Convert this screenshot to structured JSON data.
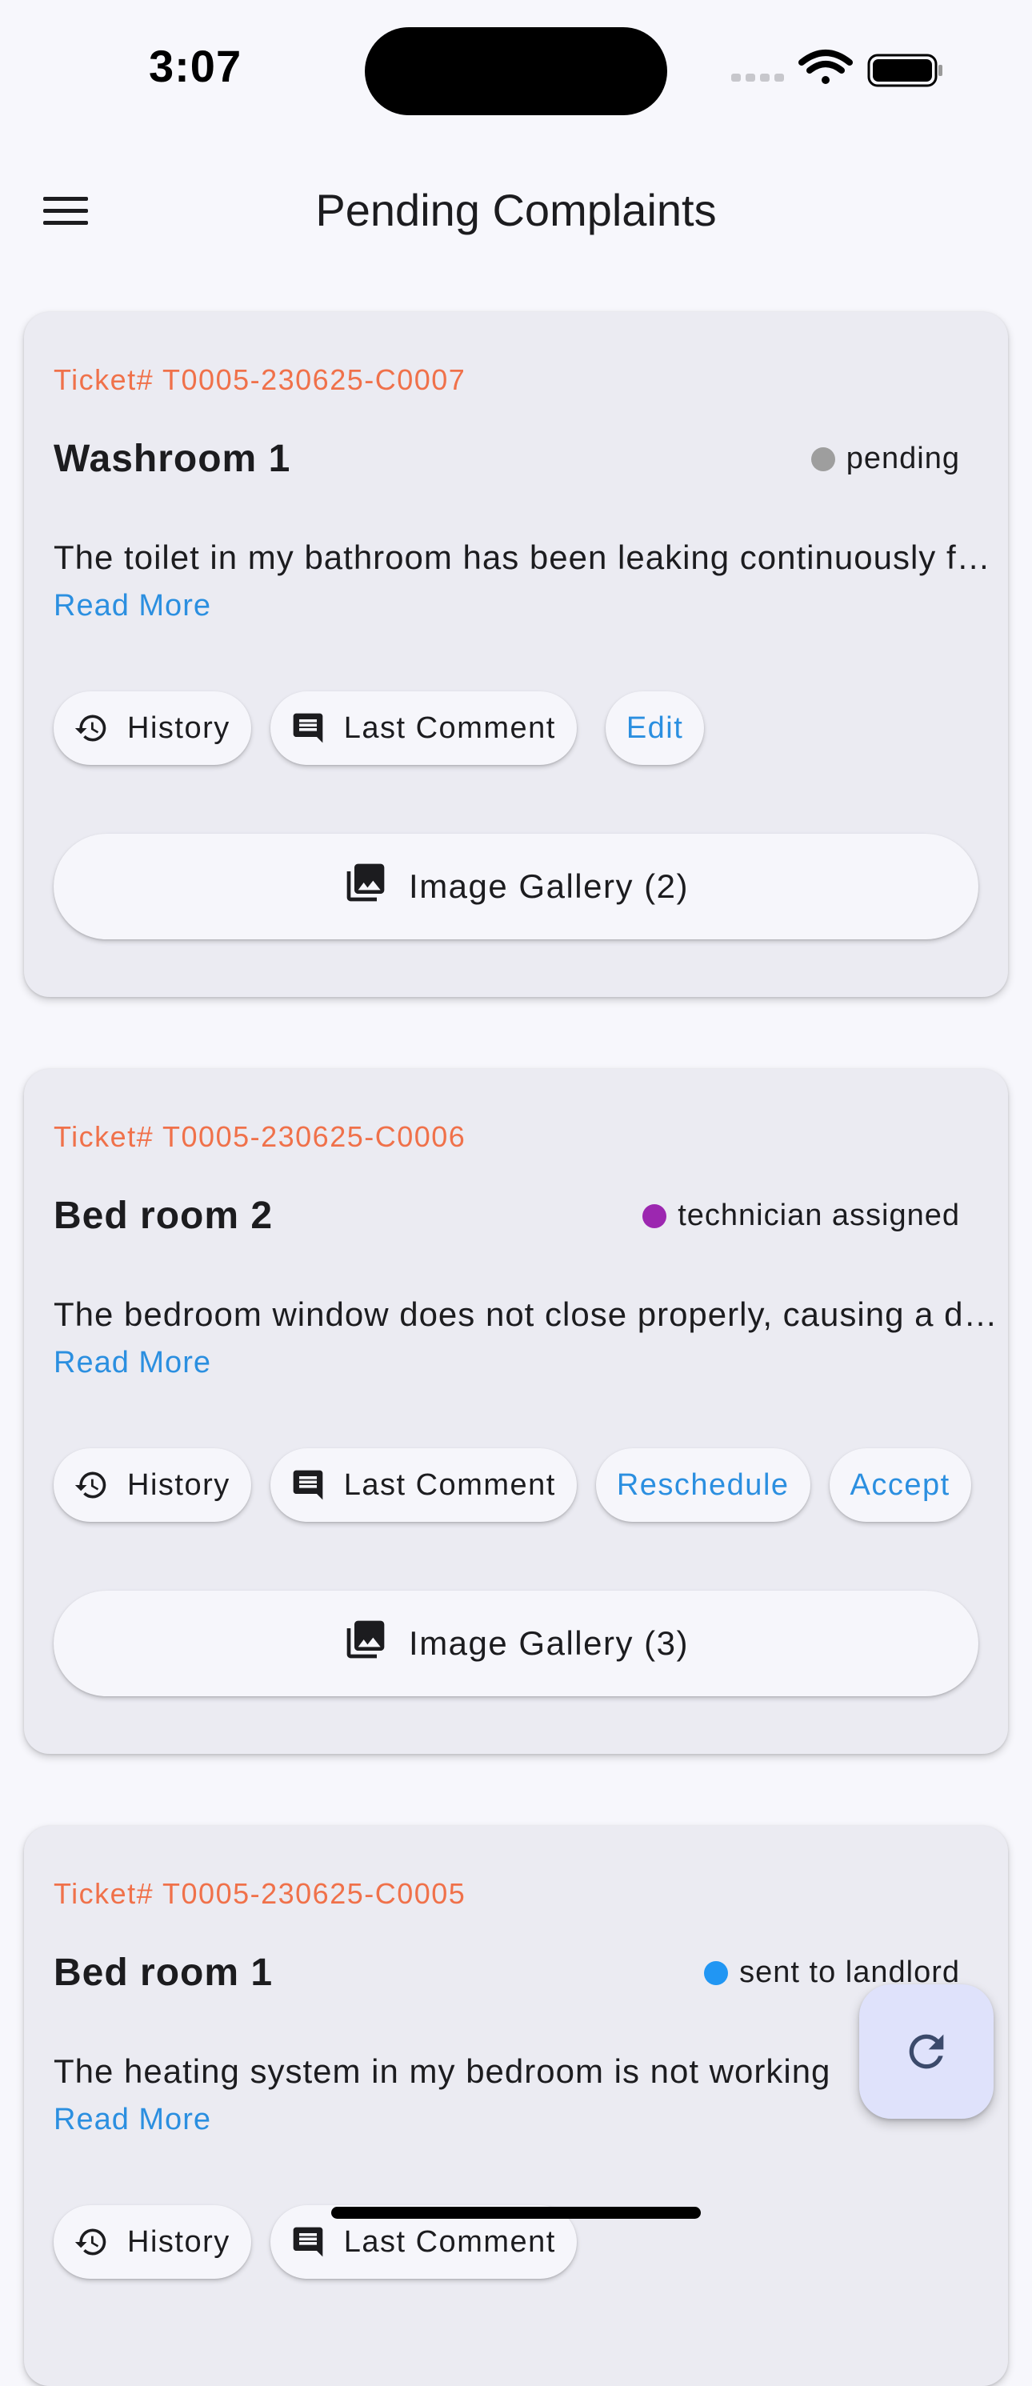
{
  "status_bar": {
    "time": "3:07"
  },
  "app_bar": {
    "title": "Pending Complaints",
    "menu_icon": "hamburger-menu-icon"
  },
  "colors": {
    "ticket_text": "#f0714a",
    "link_text": "#2b8fe0",
    "card_background": "#ebebf2",
    "page_background": "#f7f7fc",
    "status_pending": "#9e9e9e",
    "status_technician_assigned": "#9c27b0",
    "status_sent_to_landlord": "#2196f3",
    "fab_background": "#dfe2fb"
  },
  "complaints": [
    {
      "ticket": "Ticket# T0005-230625-C0007",
      "title": "Washroom 1",
      "status": "pending",
      "status_color": "#9e9e9e",
      "description": "The toilet in my bathroom has been leaking continuously for the past few days.",
      "read_more": "Read More",
      "actions": {
        "history": "History",
        "last_comment": "Last Comment",
        "edit": "Edit"
      },
      "gallery": "Image Gallery (2)"
    },
    {
      "ticket": "Ticket# T0005-230625-C0006",
      "title": "Bed room 2",
      "status": "technician assigned",
      "status_color": "#9c27b0",
      "description": "The bedroom window does not close properly, causing a draft in the room.",
      "read_more": "Read More",
      "actions": {
        "history": "History",
        "last_comment": "Last Comment",
        "reschedule": "Reschedule",
        "accept": "Accept"
      },
      "gallery": "Image Gallery (3)"
    },
    {
      "ticket": "Ticket# T0005-230625-C0005",
      "title": "Bed room 1",
      "status": "sent to landlord",
      "status_color": "#2196f3",
      "description": "The heating system in my bedroom is not working",
      "read_more": "Read More",
      "actions": {
        "history": "History",
        "last_comment": "Last Comment"
      }
    }
  ],
  "fab": {
    "icon": "refresh-icon"
  }
}
